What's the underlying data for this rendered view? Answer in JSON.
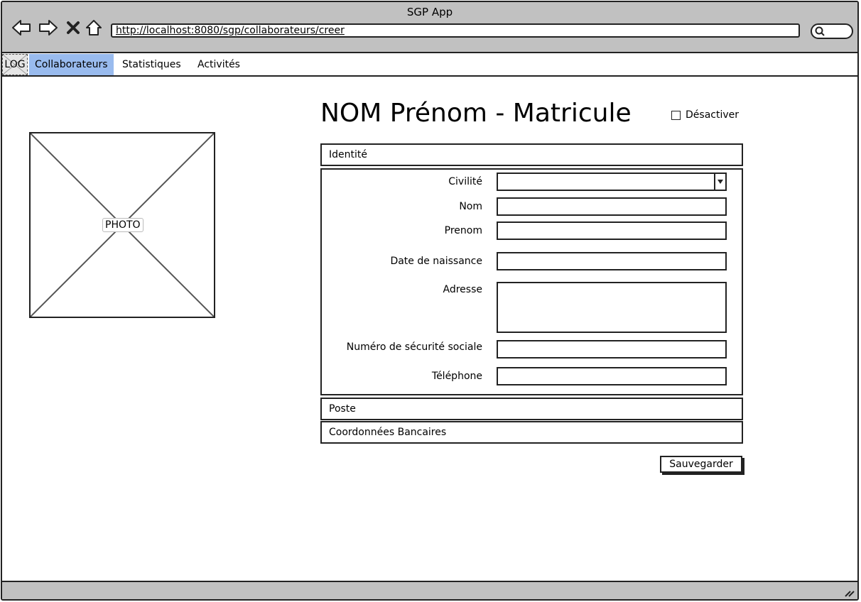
{
  "window": {
    "title": "SGP App"
  },
  "browser": {
    "url": "http://localhost:8080/sgp/collaborateurs/creer"
  },
  "menu": {
    "logo": "LOG",
    "items": [
      {
        "label": "Collaborateurs",
        "active": true
      },
      {
        "label": "Statistiques",
        "active": false
      },
      {
        "label": "Activités",
        "active": false
      }
    ]
  },
  "photo": {
    "label": "PHOTO"
  },
  "header": {
    "title": "NOM Prénom - Matricule",
    "deactivate_label": "Désactiver",
    "deactivate_checked": false
  },
  "sections": {
    "identite": "Identité",
    "poste": "Poste",
    "coordonnees": "Coordonnées Bancaires"
  },
  "form": {
    "civilite": {
      "label": "Civilité",
      "value": ""
    },
    "nom": {
      "label": "Nom",
      "value": ""
    },
    "prenom": {
      "label": "Prenom",
      "value": ""
    },
    "date_naissance": {
      "label": "Date de naissance",
      "value": ""
    },
    "adresse": {
      "label": "Adresse",
      "value": ""
    },
    "secu": {
      "label": "Numéro de sécurité sociale",
      "value": ""
    },
    "telephone": {
      "label": "Téléphone",
      "value": ""
    }
  },
  "actions": {
    "save_label": "Sauvegarder"
  },
  "colors": {
    "chrome": "#c1c1c1",
    "active_menu": "#99bbee"
  }
}
